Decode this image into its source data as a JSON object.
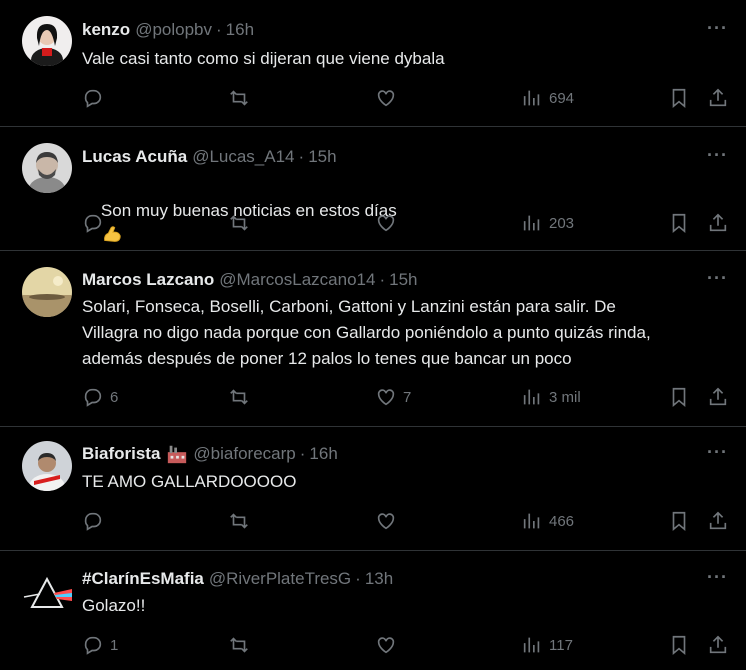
{
  "tweets": [
    {
      "name": "kenzo",
      "handle": "@polopbv",
      "time": "16h",
      "text": "Vale casi tanto como si dijeran que viene dybala",
      "replies": "",
      "retweets": "",
      "likes": "",
      "views": "694"
    },
    {
      "name": "Lucas Acuña",
      "handle": "@Lucas_A14",
      "time": "15h",
      "text": "Son muy buenas noticias en estos días",
      "emoji": "flexed-biceps",
      "replies": "",
      "retweets": "",
      "likes": "",
      "views": "203"
    },
    {
      "name": "Marcos Lazcano",
      "handle": "@MarcosLazcano14",
      "time": "15h",
      "text": "Solari, Fonseca, Boselli, Carboni, Gattoni y Lanzini están para salir. De\nVillagra no digo nada porque con Gallardo poniéndolo a punto quizás rinda,\nademás después de poner 12 palos lo tenes que bancar un poco",
      "replies": "6",
      "retweets": "",
      "likes": "7",
      "views": "3 mil"
    },
    {
      "name": "Biaforista",
      "handle": "@biaforecarp",
      "time": "16h",
      "text": "TE AMO GALLARDOOOOO",
      "emoji_after_name": "factory",
      "replies": "",
      "retweets": "",
      "likes": "",
      "views": "466"
    },
    {
      "name": "#ClarínEsMafia",
      "handle": "@RiverPlateTresG",
      "time": "13h",
      "text": "Golazo!!",
      "replies": "1",
      "retweets": "",
      "likes": "",
      "views": "117"
    }
  ],
  "ui": {
    "dot": "·",
    "more": "···"
  },
  "colors": {
    "background": "#000000",
    "text": "#e7e9ea",
    "muted": "#71767b",
    "border": "#2f3336"
  }
}
